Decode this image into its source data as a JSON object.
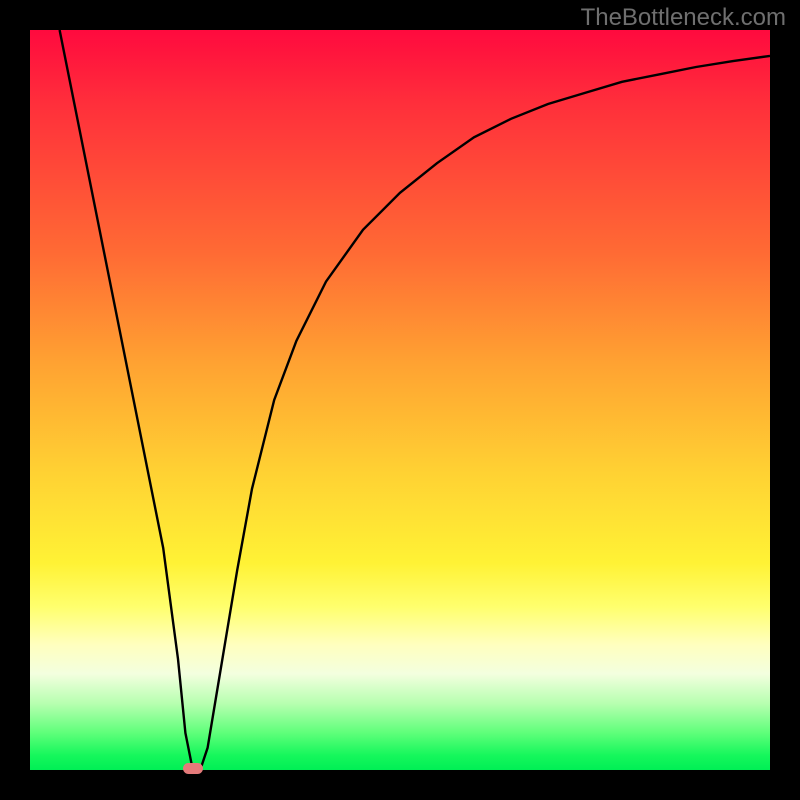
{
  "watermark": "TheBottleneck.com",
  "chart_data": {
    "type": "line",
    "title": "",
    "xlabel": "",
    "ylabel": "",
    "xlim": [
      0,
      100
    ],
    "ylim": [
      0,
      100
    ],
    "grid": false,
    "legend": false,
    "series": [
      {
        "name": "bottleneck-curve",
        "x": [
          4,
          6,
          8,
          10,
          12,
          14,
          16,
          18,
          20,
          21,
          22,
          23,
          24,
          26,
          28,
          30,
          33,
          36,
          40,
          45,
          50,
          55,
          60,
          65,
          70,
          75,
          80,
          85,
          90,
          95,
          100
        ],
        "y": [
          100,
          90,
          80,
          70,
          60,
          50,
          40,
          30,
          15,
          5,
          0,
          0,
          3,
          15,
          27,
          38,
          50,
          58,
          66,
          73,
          78,
          82,
          85.5,
          88,
          90,
          91.5,
          93,
          94,
          95,
          95.8,
          96.5
        ]
      }
    ],
    "marker": {
      "x": 22,
      "y": 0,
      "color": "#e47a7a"
    },
    "background_gradient": {
      "direction": "vertical",
      "stops": [
        {
          "pos": 0,
          "color": "#ff0a3e"
        },
        {
          "pos": 0.3,
          "color": "#ff6a34"
        },
        {
          "pos": 0.6,
          "color": "#ffd233"
        },
        {
          "pos": 0.83,
          "color": "#ffffbe"
        },
        {
          "pos": 1.0,
          "color": "#00ef55"
        }
      ]
    }
  }
}
